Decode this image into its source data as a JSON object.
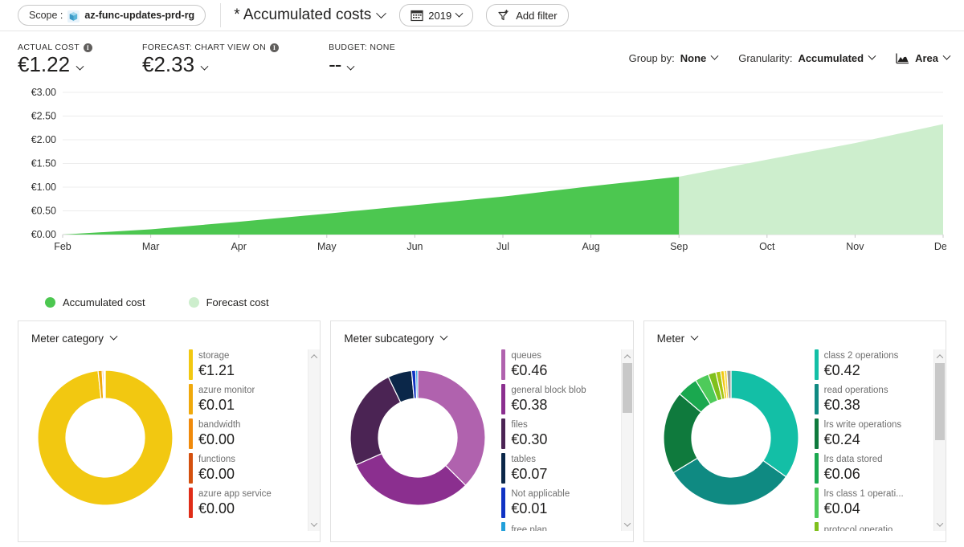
{
  "commandbar": {
    "scope_label": "Scope :",
    "scope_value": "az-func-updates-prd-rg",
    "scope_icon": "resource-group-icon",
    "view_title": "* Accumulated costs",
    "date_range": "2019",
    "date_icon": "calendar-icon",
    "add_filter": "Add filter",
    "filter_icon": "add-filter-icon"
  },
  "kpis": {
    "actual": {
      "label": "ACTUAL COST",
      "value": "€1.22",
      "info": "i"
    },
    "forecast": {
      "label": "FORECAST: CHART VIEW ON",
      "value": "€2.33",
      "info": "i"
    },
    "budget": {
      "label": "BUDGET: NONE",
      "value": "--"
    }
  },
  "controls": {
    "group_by_key": "Group by:",
    "group_by_value": "None",
    "granularity_key": "Granularity:",
    "granularity_value": "Accumulated",
    "chart_type_value": "Area",
    "chart_type_icon": "area-chart-icon"
  },
  "legend": [
    {
      "label": "Accumulated cost",
      "color": "#4cc750"
    },
    {
      "label": "Forecast cost",
      "color": "#cdeecd"
    }
  ],
  "chart_data": {
    "type": "area",
    "title": "Accumulated costs",
    "xlabel": "",
    "ylabel": "",
    "ylim": [
      0,
      3.0
    ],
    "yticks": [
      "€0.00",
      "€0.50",
      "€1.00",
      "€1.50",
      "€2.00",
      "€2.50",
      "€3.00"
    ],
    "ytick_values": [
      0,
      0.5,
      1.0,
      1.5,
      2.0,
      2.5,
      3.0
    ],
    "categories": [
      "Feb",
      "Mar",
      "Apr",
      "May",
      "Jun",
      "Jul",
      "Aug",
      "Sep",
      "Oct",
      "Nov",
      "Dec"
    ],
    "grid": true,
    "legend_position": "bottom-left",
    "currency": "EUR",
    "series": [
      {
        "name": "Accumulated cost",
        "color": "#4cc750",
        "values": [
          0.0,
          0.11,
          0.27,
          0.44,
          0.62,
          0.8,
          1.02,
          1.22,
          null,
          null,
          null
        ]
      },
      {
        "name": "Forecast cost",
        "color": "#cdeecd",
        "values": [
          null,
          null,
          null,
          null,
          null,
          null,
          null,
          1.22,
          1.58,
          1.93,
          2.33
        ]
      }
    ]
  },
  "cards": [
    {
      "title": "Meter category",
      "donut_id": "meter-category-donut",
      "scrollbar": {
        "thumb_top": 0,
        "thumb_height": 0
      },
      "items": [
        {
          "name": "storage",
          "value": "€1.21",
          "amount": 1.21,
          "color": "#f2c811"
        },
        {
          "name": "azure monitor",
          "value": "€0.01",
          "amount": 0.012,
          "color": "#f0a90b"
        },
        {
          "name": "bandwidth",
          "value": "€0.00",
          "amount": 0.004,
          "color": "#f08a0b"
        },
        {
          "name": "functions",
          "value": "€0.00",
          "amount": 0.003,
          "color": "#d4500e"
        },
        {
          "name": "azure app service",
          "value": "€0.00",
          "amount": 0.002,
          "color": "#e02d18"
        }
      ]
    },
    {
      "title": "Meter subcategory",
      "donut_id": "meter-subcategory-donut",
      "scrollbar": {
        "thumb_top": 0,
        "thumb_height": 62
      },
      "items": [
        {
          "name": "queues",
          "value": "€0.46",
          "amount": 0.46,
          "color": "#b062ae"
        },
        {
          "name": "general block blob",
          "value": "€0.38",
          "amount": 0.38,
          "color": "#8b2f8f"
        },
        {
          "name": "files",
          "value": "€0.30",
          "amount": 0.3,
          "color": "#4b2454"
        },
        {
          "name": "tables",
          "value": "€0.07",
          "amount": 0.07,
          "color": "#0b2749"
        },
        {
          "name": "Not applicable",
          "value": "€0.01",
          "amount": 0.012,
          "color": "#1033c4"
        },
        {
          "name": "free plan",
          "value": "",
          "amount": 0.006,
          "color": "#23a0da"
        }
      ]
    },
    {
      "title": "Meter",
      "donut_id": "meter-donut",
      "scrollbar": {
        "thumb_top": 0,
        "thumb_height": 96
      },
      "items": [
        {
          "name": "class 2 operations",
          "value": "€0.42",
          "amount": 0.42,
          "color": "#13bfa6"
        },
        {
          "name": "read operations",
          "value": "€0.38",
          "amount": 0.38,
          "color": "#0f8a82"
        },
        {
          "name": "lrs write operations",
          "value": "€0.24",
          "amount": 0.24,
          "color": "#0f7a3d"
        },
        {
          "name": "lrs data stored",
          "value": "€0.06",
          "amount": 0.06,
          "color": "#1aa84f"
        },
        {
          "name": "lrs class 1 operati...",
          "value": "€0.04",
          "amount": 0.04,
          "color": "#4ecb5a"
        },
        {
          "name": "protocol operatio...",
          "value": "",
          "amount": 0.022,
          "color": "#7fc01c"
        },
        {
          "name": "",
          "value": "",
          "amount": 0.014,
          "color": "#a8c613"
        },
        {
          "name": "",
          "value": "",
          "amount": 0.01,
          "color": "#f2c811"
        },
        {
          "name": "",
          "value": "",
          "amount": 0.008,
          "color": "#f5d84a"
        },
        {
          "name": "",
          "value": "",
          "amount": 0.012,
          "color": "#9a9a9a"
        }
      ]
    }
  ]
}
